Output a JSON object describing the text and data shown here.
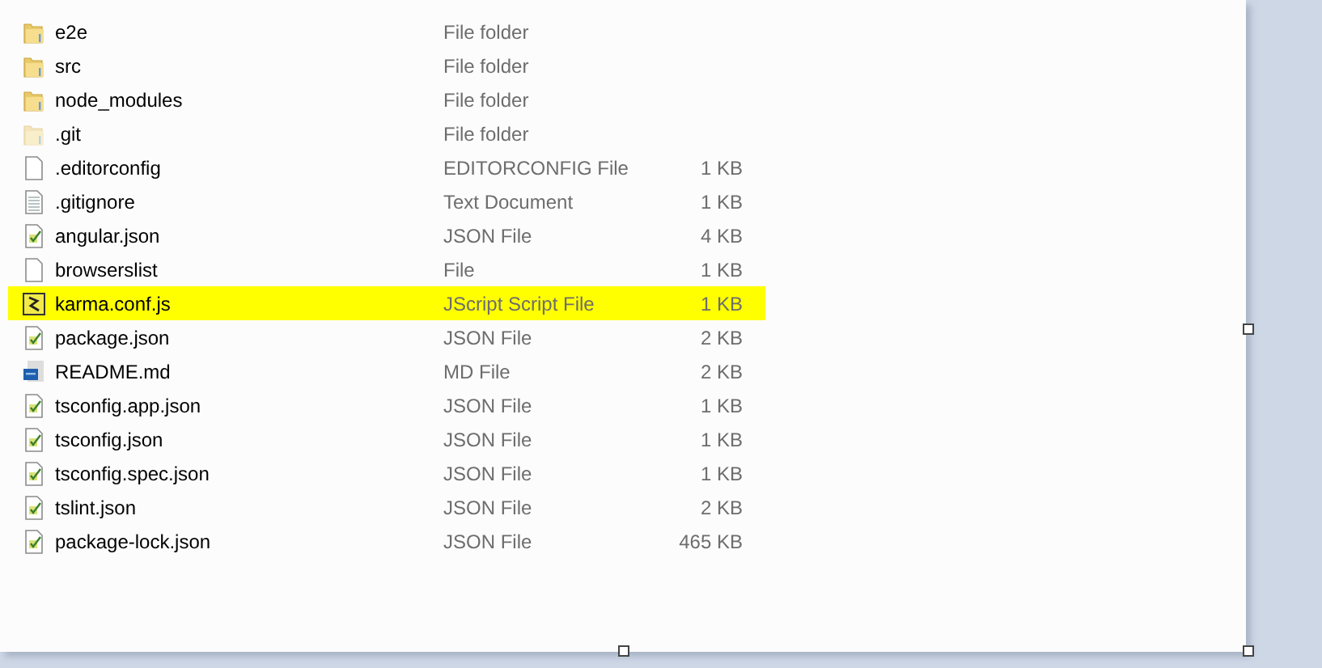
{
  "files": [
    {
      "name": "e2e",
      "type": "File folder",
      "kind": "folder",
      "hidden": false,
      "selected": false
    },
    {
      "name": "src",
      "type": "File folder",
      "kind": "folder",
      "hidden": false,
      "selected": false
    },
    {
      "name": "node_modules",
      "type": "File folder",
      "kind": "folder",
      "hidden": false,
      "selected": false
    },
    {
      "name": ".git",
      "type": "File folder",
      "kind": "folder",
      "hidden": true,
      "selected": false
    },
    {
      "name": ".editorconfig",
      "type": "EDITORCONFIG File",
      "size": "1 KB",
      "kind": "blank",
      "hidden": false,
      "selected": false
    },
    {
      "name": ".gitignore",
      "type": "Text Document",
      "size": "1 KB",
      "kind": "text",
      "hidden": false,
      "selected": false
    },
    {
      "name": "angular.json",
      "type": "JSON File",
      "size": "4 KB",
      "kind": "json",
      "hidden": false,
      "selected": false
    },
    {
      "name": "browserslist",
      "type": "File",
      "size": "1 KB",
      "kind": "blank",
      "hidden": false,
      "selected": false
    },
    {
      "name": "karma.conf.js",
      "type": "JScript Script File",
      "size": "1 KB",
      "kind": "script",
      "hidden": false,
      "selected": true
    },
    {
      "name": "package.json",
      "type": "JSON File",
      "size": "2 KB",
      "kind": "json",
      "hidden": false,
      "selected": false
    },
    {
      "name": "README.md",
      "type": "MD File",
      "size": "2 KB",
      "kind": "md",
      "hidden": false,
      "selected": false
    },
    {
      "name": "tsconfig.app.json",
      "type": "JSON File",
      "size": "1 KB",
      "kind": "json",
      "hidden": false,
      "selected": false
    },
    {
      "name": "tsconfig.json",
      "type": "JSON File",
      "size": "1 KB",
      "kind": "json",
      "hidden": false,
      "selected": false
    },
    {
      "name": "tsconfig.spec.json",
      "type": "JSON File",
      "size": "1 KB",
      "kind": "json",
      "hidden": false,
      "selected": false
    },
    {
      "name": "tslint.json",
      "type": "JSON File",
      "size": "2 KB",
      "kind": "json",
      "hidden": false,
      "selected": false
    },
    {
      "name": "package-lock.json",
      "type": "JSON File",
      "size": "465 KB",
      "kind": "json",
      "hidden": false,
      "selected": false
    }
  ]
}
